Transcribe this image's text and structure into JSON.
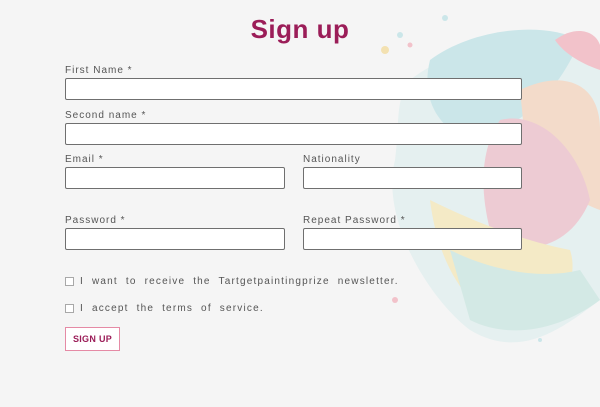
{
  "page": {
    "title": "Sign up"
  },
  "form": {
    "first_name": {
      "label": "First  Name  *",
      "value": "",
      "placeholder": ""
    },
    "second_name": {
      "label": "Second  name  *",
      "value": "",
      "placeholder": ""
    },
    "email": {
      "label": "Email  *",
      "value": "",
      "placeholder": ""
    },
    "nationality": {
      "label": "Nationality",
      "value": "",
      "placeholder": ""
    },
    "password": {
      "label": "Password  *",
      "value": "",
      "placeholder": ""
    },
    "repeat_password": {
      "label": "Repeat  Password  *",
      "value": "",
      "placeholder": ""
    },
    "newsletter": {
      "label": "I  want  to  receive  the  Tartgetpaintingprize  newsletter.",
      "checked": false
    },
    "terms": {
      "label": "I  accept  the  terms  of  service.",
      "checked": false
    },
    "submit_label": "SIGN UP"
  },
  "colors": {
    "accent": "#9b1d58",
    "button_border": "#e58aa5",
    "background": "#f5f5f5"
  }
}
